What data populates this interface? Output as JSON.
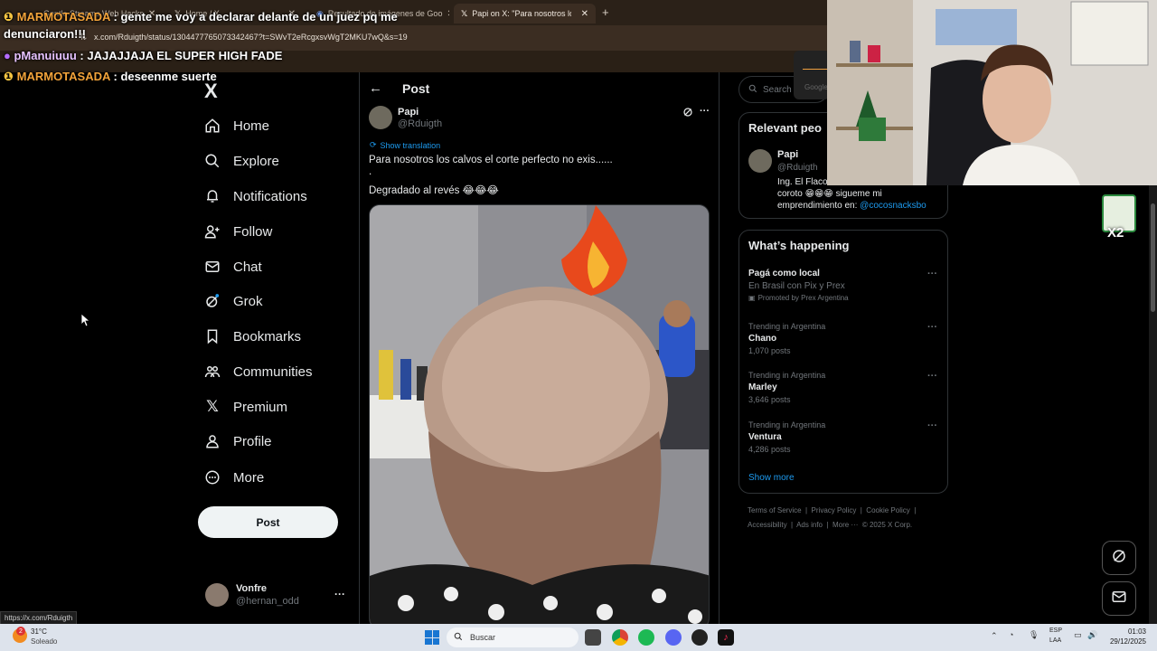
{
  "browser": {
    "tabs": [
      {
        "title": "Gentle Streams Web Hacks",
        "active": false
      },
      {
        "title": "Home / X",
        "active": false
      },
      {
        "title": "Resultado de imágenes de Goo",
        "active": false
      },
      {
        "title": "Papi on X: \"Para nosotros los ca",
        "active": true
      }
    ],
    "new_tab": "+",
    "url": "x.com/Rduigth/status/1304477765073342467?t=SWvT2eRcgxsvWgT2MKU7wQ&s=19",
    "status_url": "https://x.com/Rduigth"
  },
  "chat": [
    {
      "user": "MARMOTASADA",
      "sep": " : ",
      "message": "gente me voy a declarar delante de un juez pq me"
    },
    {
      "user": "",
      "sep": "",
      "message": "denunciaron!!!"
    },
    {
      "user": "pManuiuuu",
      "sep": " : ",
      "message": "JAJAJJAJA EL SUPER HIGH FADE"
    },
    {
      "user": "MARMOTASADA",
      "sep": " : ",
      "message": "deseenme suerte"
    }
  ],
  "nav": {
    "logo": "X",
    "items": [
      {
        "label": "Home",
        "icon": "home-icon"
      },
      {
        "label": "Explore",
        "icon": "search-icon"
      },
      {
        "label": "Notifications",
        "icon": "bell-icon"
      },
      {
        "label": "Follow",
        "icon": "follow-icon"
      },
      {
        "label": "Chat",
        "icon": "mail-icon"
      },
      {
        "label": "Grok",
        "icon": "grok-icon"
      },
      {
        "label": "Bookmarks",
        "icon": "bookmark-icon"
      },
      {
        "label": "Communities",
        "icon": "communities-icon"
      },
      {
        "label": "Premium",
        "icon": "x-icon"
      },
      {
        "label": "Profile",
        "icon": "person-icon"
      },
      {
        "label": "More",
        "icon": "more-circle-icon"
      }
    ],
    "post_button": "Post",
    "account": {
      "name": "Vonfre",
      "handle": "@hernan_odd",
      "menu": "···"
    }
  },
  "post": {
    "header_title": "Post",
    "author_name": "Papi",
    "author_handle": "@Rduigth",
    "show_translation": "Show translation",
    "text_line1": "Para nosotros los calvos el corte perfecto no exis......",
    "text_line2": ".",
    "text_line3": "Degradado al revés 😂😂😂"
  },
  "right": {
    "search_placeholder": "Search",
    "relevant_title": "Relevant peo",
    "relevant_name": "Papi",
    "relevant_handle": "@Rduigth",
    "relevant_bio_1": "Ing. El Flaco",
    "relevant_bio_2": "coroto 😁😁😁 sigueme mi",
    "relevant_bio_3": "emprendimiento en: ",
    "relevant_bio_link": "@cocosnacksbo",
    "happening_title": "What’s happening",
    "promo": {
      "name": "Pagá como local",
      "desc": "En Brasil con Pix y Prex",
      "promoted": "Promoted by Prex Argentina"
    },
    "trends": [
      {
        "label": "Trending in Argentina",
        "name": "Chano",
        "posts": "1,070 posts"
      },
      {
        "label": "Trending in Argentina",
        "name": "Marley",
        "posts": "3,646 posts"
      },
      {
        "label": "Trending in Argentina",
        "name": "Ventura",
        "posts": "4,286 posts"
      }
    ],
    "show_more": "Show more",
    "footer_1": "Terms of Service  |  Privacy Policy  |  Cookie Policy  |",
    "footer_2": "Accessibility  |  Ads info  |  More ···  © 2025 X Corp."
  },
  "overlay": {
    "google_text": "Google",
    "badge_text": "X2"
  },
  "taskbar": {
    "weather_temp": "31°C",
    "weather_desc": "Soleado",
    "search": "Buscar",
    "lang_1": "ESP",
    "lang_2": "LAA",
    "time": "01:03",
    "date": "29/12/2025",
    "notif_badge": "2"
  },
  "colors": {
    "accent": "#1d9bf0",
    "chat_user": "#f2a33a",
    "background": "#000000"
  }
}
